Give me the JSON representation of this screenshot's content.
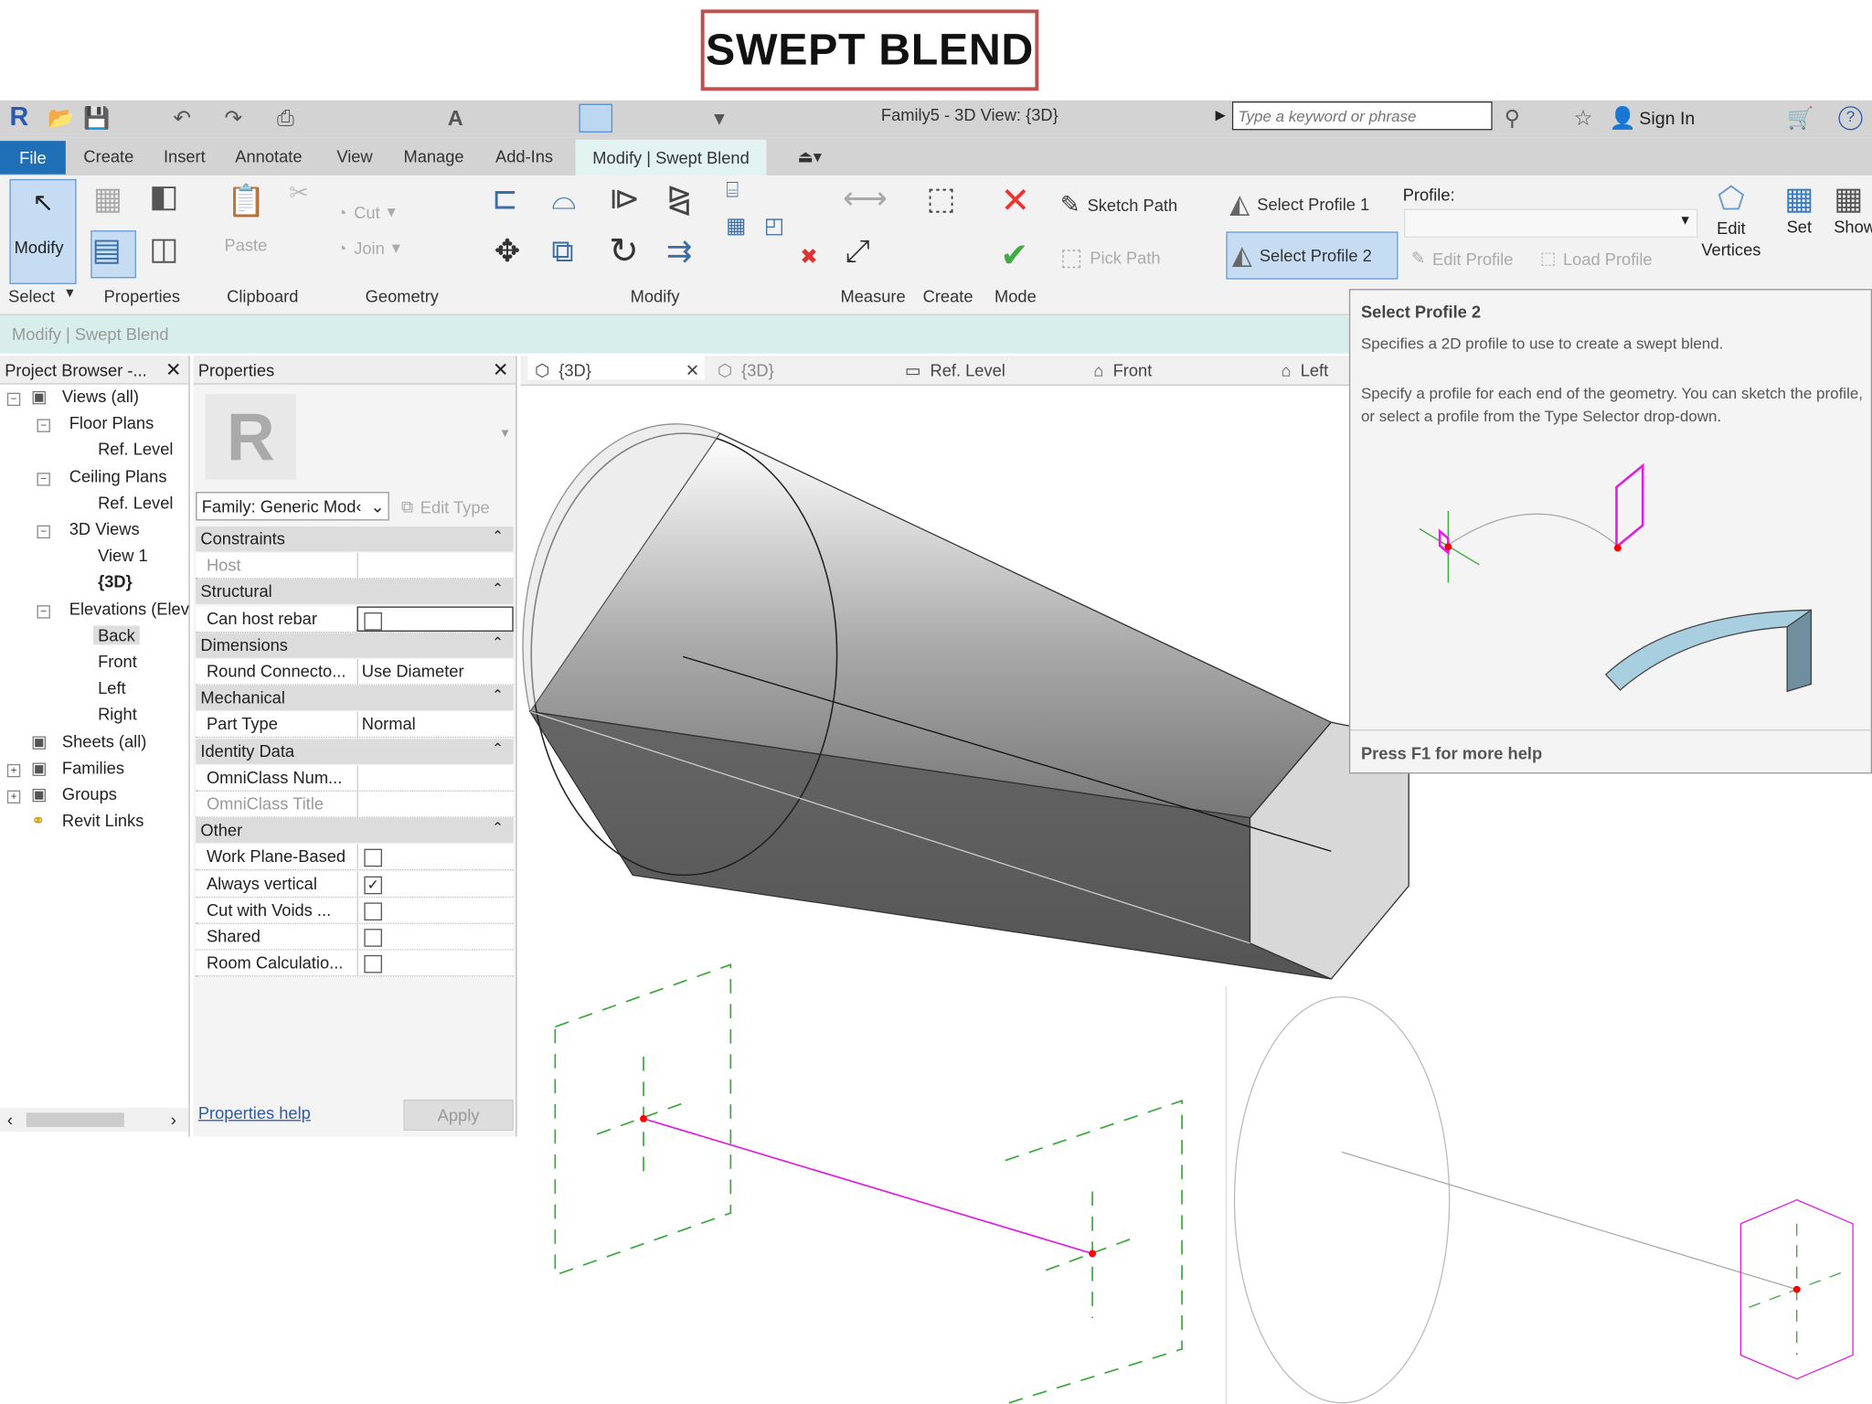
{
  "slide_title": "SWEPT BLEND",
  "app": {
    "title": "Family5 - 3D View: {3D}",
    "search_placeholder": "Type a keyword or phrase",
    "sign_in": "Sign In"
  },
  "tabs": [
    "File",
    "Create",
    "Insert",
    "Annotate",
    "View",
    "Manage",
    "Add-Ins",
    "Modify | Swept Blend"
  ],
  "ribbon": {
    "modify_btn": "Modify",
    "select": "Select",
    "properties": "Properties",
    "clipboard": "Clipboard",
    "paste": "Paste",
    "cut": "Cut",
    "join": "Join",
    "geometry": "Geometry",
    "modify_panel": "Modify",
    "measure": "Measure",
    "create": "Create",
    "mode": "Mode",
    "sketch_path": "Sketch Path",
    "pick_path": "Pick Path",
    "select_profile_1": "Select Profile 1",
    "select_profile_2": "Select Profile 2",
    "profile_label": "Profile:",
    "edit_profile": "Edit Profile",
    "load_profile": "Load Profile",
    "edit_vertices": "Edit Vertices",
    "set": "Set",
    "show": "Show"
  },
  "options_bar": "Modify | Swept Blend",
  "browser": {
    "title": "Project Browser -...",
    "items": [
      "Views (all)",
      "Floor Plans",
      "Ref. Level",
      "Ceiling Plans",
      "Ref. Level",
      "3D Views",
      "View 1",
      "{3D}",
      "Elevations (Elev",
      "Back",
      "Front",
      "Left",
      "Right",
      "Sheets (all)",
      "Families",
      "Groups",
      "Revit Links"
    ]
  },
  "properties": {
    "title": "Properties",
    "family": "Family: Generic Mod‹",
    "edit_type": "Edit Type",
    "groups": {
      "constraints": "Constraints",
      "structural": "Structural",
      "dimensions": "Dimensions",
      "mechanical": "Mechanical",
      "identity": "Identity Data",
      "other": "Other"
    },
    "rows": {
      "host": "Host",
      "can_host_rebar": "Can host rebar",
      "round_conn": "Round Connecto...",
      "round_conn_val": "Use Diameter",
      "part_type": "Part Type",
      "part_type_val": "Normal",
      "omni_num": "OmniClass Num...",
      "omni_title": "OmniClass Title",
      "work_plane": "Work Plane-Based",
      "always_vertical": "Always vertical",
      "cut_voids": "Cut with Voids ...",
      "shared": "Shared",
      "room_calc": "Room Calculatio..."
    },
    "checks": {
      "can_host_rebar": false,
      "work_plane": false,
      "always_vertical": true,
      "cut_voids": false,
      "shared": false,
      "room_calc": false
    },
    "help": "Properties help",
    "apply": "Apply"
  },
  "view_tabs": [
    "{3D}",
    "{3D}",
    "Ref. Level",
    "Front",
    "Left"
  ],
  "tooltip": {
    "title": "Select Profile 2",
    "line1": "Specifies a 2D profile to use to create a swept blend.",
    "line2": "Specify a profile for each end of the geometry. You can sketch the profile, or select a profile from the Type Selector drop-down.",
    "footer": "Press F1 for more help"
  },
  "colors": {
    "file_tab": "#1e6fb5",
    "active_tab": "#e2f3f1",
    "title_border": "#c0504d",
    "profile": "#e020e0",
    "dashed": "#3aa83a"
  }
}
